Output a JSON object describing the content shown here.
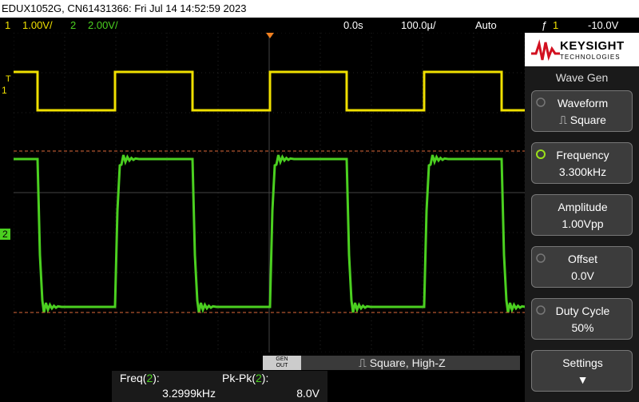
{
  "titlebar": {
    "text": "EDUX1052G, CN61431366: Fri Jul 14 14:52:59 2023"
  },
  "status": {
    "ch1_num": "1",
    "ch1_scale": "1.00V/",
    "ch2_num": "2",
    "ch2_scale": "2.00V/",
    "time_delay": "0.0s",
    "time_scale": "100.0µ/",
    "mode": "Auto",
    "trigger_slope": "ƒ",
    "trigger_source": "1",
    "trigger_level": "-10.0V"
  },
  "markers": {
    "trigger_mark": "T",
    "ch1_mark": "1",
    "ch2_mark": "2"
  },
  "colors": {
    "ch1": "#f0e000",
    "ch2": "#4bd020",
    "cursor": "#e06a3a",
    "grid": "#444444"
  },
  "brand": {
    "name": "KEYSIGHT",
    "sub": "TECHNOLOGIES"
  },
  "panel": {
    "title": "Wave Gen",
    "softkeys": [
      {
        "label": "Waveform",
        "value": "⎍ Square"
      },
      {
        "label": "Frequency",
        "value": "3.300kHz"
      },
      {
        "label": "Amplitude",
        "value": "1.00Vpp"
      },
      {
        "label": "Offset",
        "value": "0.0V"
      },
      {
        "label": "Duty Cycle",
        "value": "50%"
      },
      {
        "label": "Settings",
        "value": "▼"
      }
    ]
  },
  "gen": {
    "out_label_1": "GEN",
    "out_label_2": "OUT",
    "summary": "⎍ Square, High-Z"
  },
  "measurements": [
    {
      "label": "Freq(",
      "ch": "2",
      "close": "):",
      "value": "3.2999kHz"
    },
    {
      "label": "Pk-Pk(",
      "ch": "2",
      "close": "):",
      "value": "8.0V"
    }
  ],
  "chart_data": {
    "type": "line",
    "series": [
      {
        "name": "1",
        "shape": "square",
        "low": 0,
        "high": 1
      },
      {
        "name": "2",
        "shape": "square_with_ringing",
        "low": 0,
        "high": 1
      }
    ]
  }
}
